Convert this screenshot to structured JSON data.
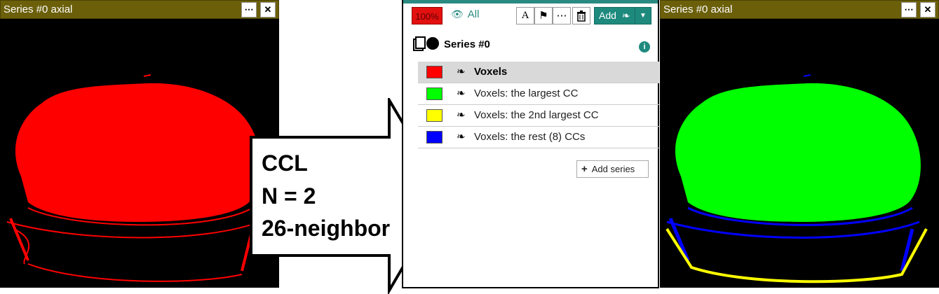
{
  "left_viewer": {
    "title": "Series #0 axial",
    "more_label": "⋯",
    "close_label": "✕"
  },
  "right_viewer": {
    "title": "Series #0 axial",
    "more_label": "⋯",
    "close_label": "✕"
  },
  "arrow": {
    "lines": [
      "CCL",
      "N = 2",
      "26-neighbor"
    ]
  },
  "panel": {
    "opacity": "100%",
    "visibility_label": "All",
    "visibility_icon": "eye-slash-icon",
    "tools": [
      {
        "name": "text-tool-button",
        "glyph": "A"
      },
      {
        "name": "marker-tool-button",
        "glyph": "⚑"
      },
      {
        "name": "more-tool-button",
        "glyph": "⋯"
      },
      {
        "name": "delete-tool-button",
        "glyph": "🗑"
      }
    ],
    "add_label": "Add",
    "series_title": "Series #0",
    "info_label": "i",
    "labels": [
      {
        "label": "Voxels",
        "color": "#ff0000",
        "selected": true
      },
      {
        "label": "Voxels: the largest CC",
        "color": "#00ff00",
        "selected": false
      },
      {
        "label": "Voxels: the 2nd largest CC",
        "color": "#ffff00",
        "selected": false
      },
      {
        "label": "Voxels: the rest (8) CCs",
        "color": "#0000ff",
        "selected": false
      }
    ],
    "add_series_label": "Add series"
  },
  "colors": {
    "title_bar": "#6b5f0a",
    "accent": "#1e8a7e",
    "left_segmentation": "#ff0000",
    "largest_cc": "#00ff00",
    "second_cc": "#ffff00",
    "rest_cc": "#0000ff"
  }
}
